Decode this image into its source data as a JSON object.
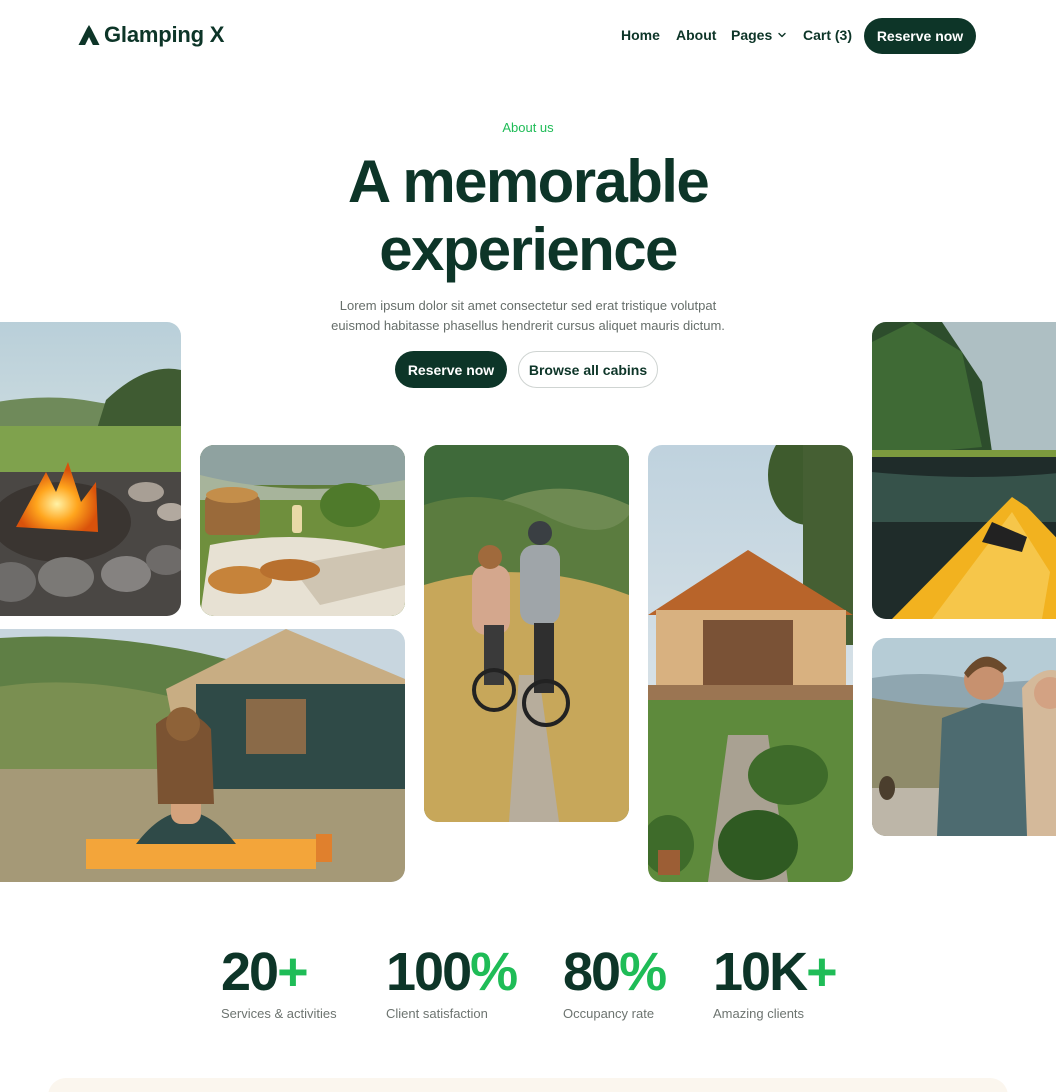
{
  "header": {
    "brand": "Glamping X",
    "nav": {
      "home": "Home",
      "about": "About",
      "pages": "Pages",
      "cart": "Cart (3)"
    },
    "cta": "Reserve now"
  },
  "hero": {
    "eyebrow": "About us",
    "title_line1": "A memorable",
    "title_line2": "experience",
    "subtitle": "Lorem ipsum dolor sit amet consectetur sed erat tristique volutpat euismod habitasse phasellus hendrerit cursus aliquet mauris dictum.",
    "primary_button": "Reserve now",
    "secondary_button": "Browse all cabins"
  },
  "gallery": [
    {
      "name": "campfire-image"
    },
    {
      "name": "picnic-image"
    },
    {
      "name": "cycling-image"
    },
    {
      "name": "tent-cabin-image"
    },
    {
      "name": "kayak-lake-image"
    },
    {
      "name": "yoga-tent-image"
    },
    {
      "name": "hikers-image"
    }
  ],
  "stats": [
    {
      "value": "20",
      "suffix": "+",
      "label": "Services & activities"
    },
    {
      "value": "100",
      "suffix": "%",
      "label": "Client satisfaction"
    },
    {
      "value": "80",
      "suffix": "%",
      "label": "Occupancy rate"
    },
    {
      "value": "10K",
      "suffix": "+",
      "label": "Amazing clients"
    }
  ],
  "colors": {
    "primary": "#0d3528",
    "accent": "#1fbc57",
    "text_muted": "#666e6a",
    "footer_bg": "#fbf6ee"
  },
  "icons": {
    "logo": "tent-logo-icon",
    "dropdown": "chevron-down-icon"
  }
}
